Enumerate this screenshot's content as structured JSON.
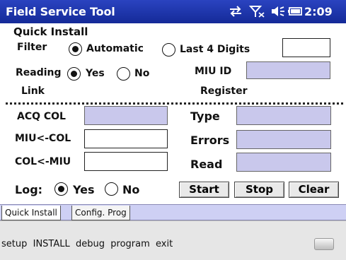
{
  "titlebar": {
    "title": "Field Service Tool",
    "time": "2:09",
    "icons": [
      "sync-icon",
      "no-signal-icon",
      "speaker-icon",
      "battery-icon"
    ]
  },
  "form": {
    "section_title": "Quick Install",
    "filter": {
      "label": "Filter",
      "options": [
        "Automatic",
        "Last 4 Digits"
      ],
      "selected": "Automatic",
      "value": ""
    },
    "reading": {
      "label": "Reading",
      "options": [
        "Yes",
        "No"
      ],
      "selected": "Yes"
    },
    "miu_id": {
      "label": "MIU ID",
      "value": ""
    },
    "col_link": "Link",
    "col_register": "Register",
    "acq_col": {
      "label": "ACQ COL",
      "value": ""
    },
    "miu_col": {
      "label": "MIU<-COL",
      "value": ""
    },
    "col_miu": {
      "label": "COL<-MIU",
      "value": ""
    },
    "type": {
      "label": "Type",
      "value": ""
    },
    "errors": {
      "label": "Errors",
      "value": ""
    },
    "read": {
      "label": "Read",
      "value": ""
    },
    "log": {
      "label": "Log:",
      "options": [
        "Yes",
        "No"
      ],
      "selected": "Yes"
    },
    "buttons": {
      "start": "Start",
      "stop": "Stop",
      "clear": "Clear"
    }
  },
  "tabs": [
    {
      "label": "Quick Install",
      "active": true
    },
    {
      "label": "Config. Prog",
      "active": false
    }
  ],
  "menubar": {
    "items": "setup  INSTALL  debug  program  exit",
    "keyboard_icon": "keyboard-icon"
  },
  "colors": {
    "titlebar": "#1f35a8",
    "field_blue": "#c9c8ec",
    "tab_strip": "#ced0f4"
  }
}
